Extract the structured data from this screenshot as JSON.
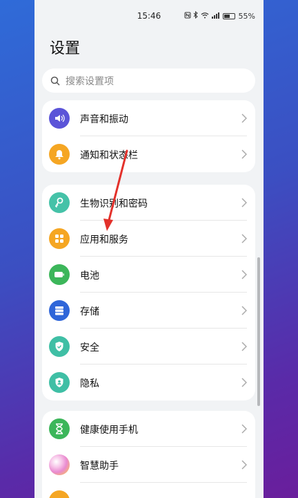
{
  "status_bar": {
    "time": "15:46",
    "icons": [
      "nfc-icon",
      "bluetooth-icon",
      "wifi-icon",
      "signal-icon",
      "battery-icon"
    ],
    "battery": "55%"
  },
  "header": {
    "title": "设置"
  },
  "search": {
    "placeholder": "搜索设置项"
  },
  "groups": [
    {
      "items": [
        {
          "label": "声音和振动",
          "icon": "speaker-icon",
          "color": "#5b54d8"
        },
        {
          "label": "通知和状态栏",
          "icon": "bell-icon",
          "color": "#f5a623"
        }
      ]
    },
    {
      "items": [
        {
          "label": "生物识别和密码",
          "icon": "key-icon",
          "color": "#45c2a8"
        },
        {
          "label": "应用和服务",
          "icon": "apps-grid-icon",
          "color": "#f5a623"
        },
        {
          "label": "电池",
          "icon": "battery-icon",
          "color": "#3cb65a"
        },
        {
          "label": "存储",
          "icon": "storage-icon",
          "color": "#2f66d9"
        },
        {
          "label": "安全",
          "icon": "shield-icon",
          "color": "#3fbfa5"
        },
        {
          "label": "隐私",
          "icon": "privacy-icon",
          "color": "#3fbfa5"
        }
      ]
    },
    {
      "items": [
        {
          "label": "健康使用手机",
          "icon": "hourglass-icon",
          "color": "#3cb65a"
        },
        {
          "label": "智慧助手",
          "icon": "assistant-icon",
          "color": "#e98ad0"
        }
      ]
    }
  ],
  "annotation_color": "#e3312b"
}
